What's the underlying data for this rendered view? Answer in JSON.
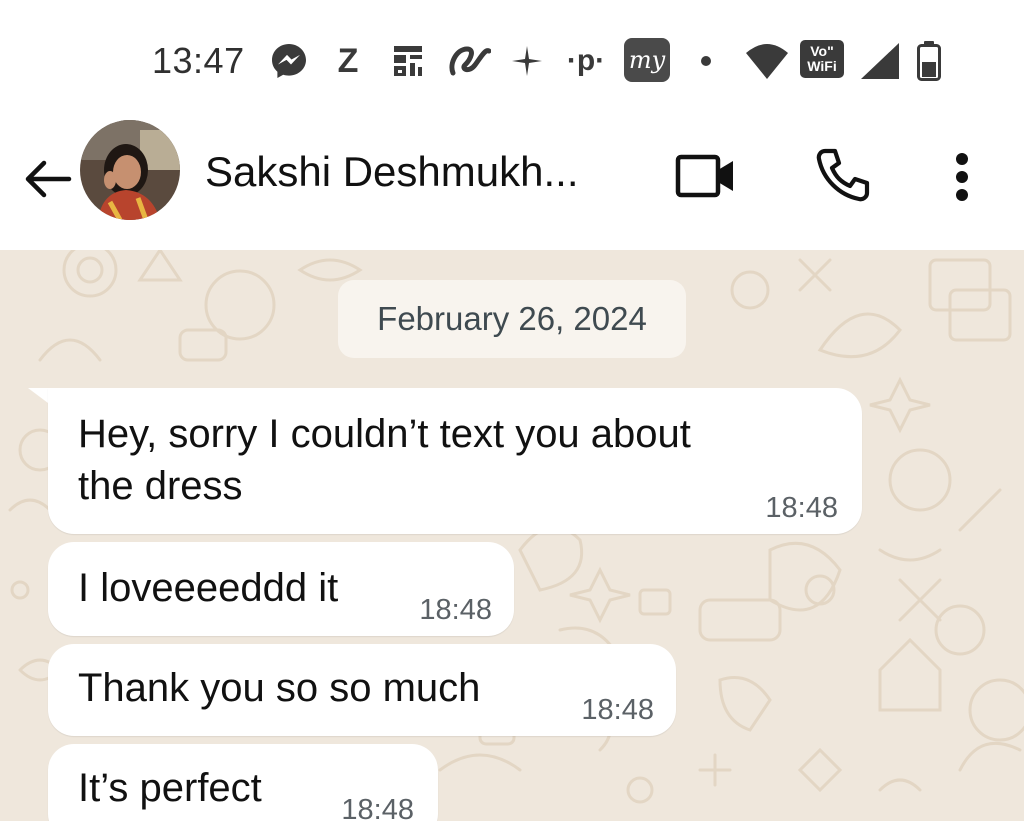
{
  "status_bar": {
    "time": "13:47",
    "icons": [
      "messenger-icon",
      "z-icon",
      "qr-app-icon",
      "app-swirl-icon",
      "sparkle-icon",
      "phonepe-icon",
      "my-app-icon",
      "dot-icon",
      "wifi-icon",
      "vowifi-icon",
      "signal-icon",
      "battery-icon"
    ],
    "z_label": "Z",
    "p_label": "·p·",
    "my_label": "my",
    "vowifi_label_top": "Vo\"",
    "vowifi_label_bottom": "WiFi"
  },
  "header": {
    "contact_name": "Sakshi Deshmukh...",
    "actions": [
      "video-call",
      "voice-call",
      "more-options"
    ]
  },
  "chat": {
    "date_chip": "February 26, 2024",
    "messages": [
      {
        "line1": "Hey, sorry I couldn’t text you about",
        "line2": "the dress",
        "time": "18:48"
      },
      {
        "text": "I loveeeeddd it",
        "time": "18:48"
      },
      {
        "text": "Thank you so so much",
        "time": "18:48"
      },
      {
        "text": "It’s perfect",
        "time": "18:48"
      }
    ]
  },
  "colors": {
    "chat_background": "#efe7dc",
    "bubble": "#ffffff",
    "date_chip": "#f8f4ee",
    "timestamp": "#5b6166"
  }
}
